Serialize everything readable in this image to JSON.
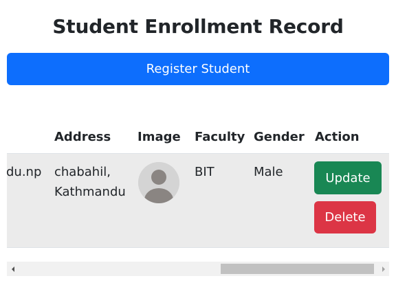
{
  "page_title": "Student Enrollment Record",
  "register_button": "Register Student",
  "table": {
    "headers": [
      "Address",
      "Image",
      "Faculty",
      "Gender",
      "Action"
    ],
    "rows": [
      {
        "email_partial": "du.np",
        "address_line1": "chabahil,",
        "address_line2": "Kathmandu",
        "image": "avatar-placeholder",
        "faculty": "BIT",
        "gender": "Male",
        "update_label": "Update",
        "delete_label": "Delete"
      }
    ]
  },
  "colors": {
    "primary": "#0d6efd",
    "success": "#198754",
    "danger": "#dc3545",
    "row_bg": "#ebebeb"
  }
}
